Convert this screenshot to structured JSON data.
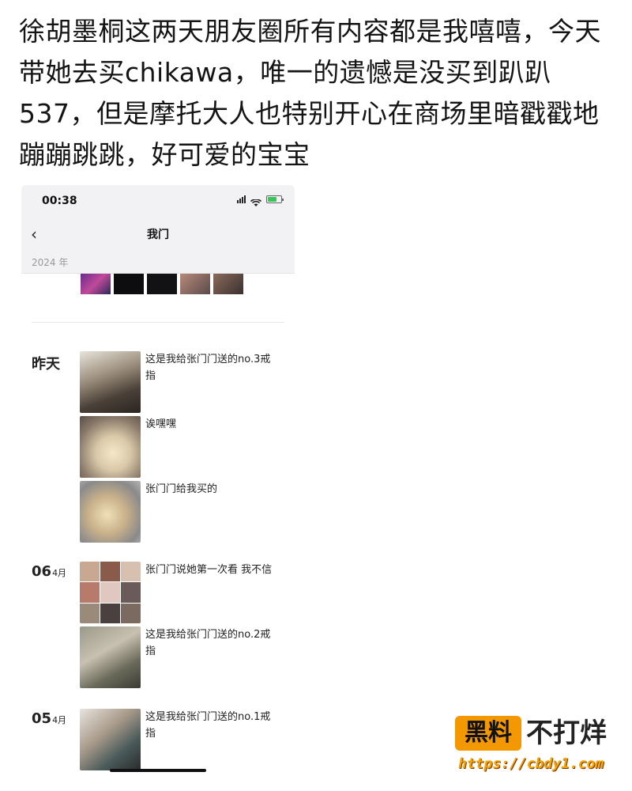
{
  "caption": "徐胡墨桐这两天朋友圈所有内容都是我嘻嘻，今天带她去买chikawa，唯一的遗憾是没买到趴趴537，但是摩托大人也特别开心在商场里暗戳戳地蹦蹦跳跳，好可爱的宝宝",
  "status_bar": {
    "time": "00:38",
    "icons": [
      "signal-icon",
      "wifi-icon",
      "battery-charging-icon"
    ]
  },
  "nav": {
    "back_icon": "chevron-left-icon",
    "title": "我门"
  },
  "year_label": "2024 年",
  "groups": [
    {
      "date": "昨天",
      "posts": [
        {
          "text": "这是我给张门门送的no.3戒指"
        },
        {
          "text": "诶嘿嘿"
        },
        {
          "text": "张门门给我买的"
        }
      ]
    },
    {
      "date_day": "06",
      "date_month": "4月",
      "posts": [
        {
          "text": "张门门说她第一次看 我不信"
        },
        {
          "text": "这是我给张门门送的no.2戒指"
        }
      ]
    },
    {
      "date_day": "05",
      "date_month": "4月",
      "posts": [
        {
          "text": "这是我给张门门送的no.1戒指"
        }
      ]
    }
  ],
  "watermark": {
    "box": "黑料",
    "text": "不打烊",
    "url": "https://cbdy1.com"
  },
  "colors": {
    "watermark_orange": "#f39800",
    "nav_bg": "#f2f2f4"
  }
}
